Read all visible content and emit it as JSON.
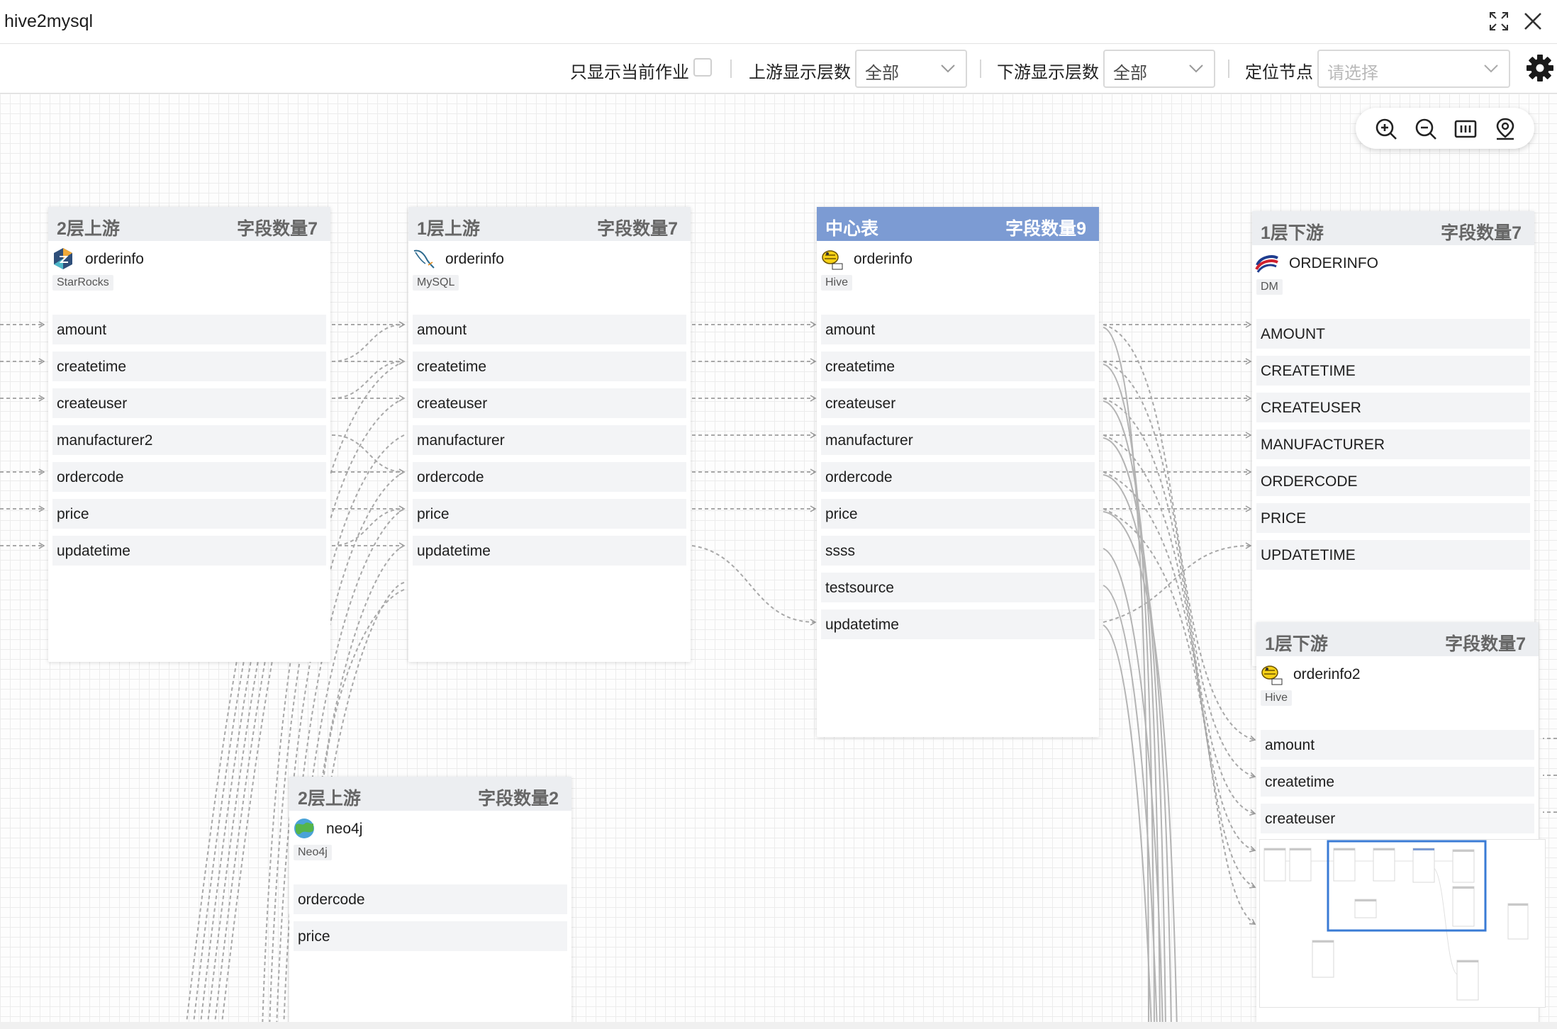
{
  "window": {
    "title": "hive2mysql",
    "controls": [
      "expand-icon",
      "close-icon"
    ]
  },
  "toolbar": {
    "only_current_label": "只显示当前作业",
    "upstream_label": "上游显示层数",
    "upstream_value": "全部",
    "downstream_label": "下游显示层数",
    "downstream_value": "全部",
    "locate_label": "定位节点",
    "locate_placeholder": "请选择",
    "settings_icon": "gear-icon"
  },
  "zoom_controls": [
    "zoom-in-icon",
    "zoom-out-icon",
    "fit-view-icon",
    "locate-icon"
  ],
  "nodes": {
    "up2_starrocks": {
      "level": "2层上游",
      "count": "字段数量7",
      "name": "orderinfo",
      "db": "StarRocks",
      "icon": "starrocks-icon",
      "fields": [
        "amount",
        "createtime",
        "createuser",
        "manufacturer2",
        "ordercode",
        "price",
        "updatetime"
      ]
    },
    "up1_mysql": {
      "level": "1层上游",
      "count": "字段数量7",
      "name": "orderinfo",
      "db": "MySQL",
      "icon": "mysql-dolphin-icon",
      "fields": [
        "amount",
        "createtime",
        "createuser",
        "manufacturer",
        "ordercode",
        "price",
        "updatetime"
      ]
    },
    "center_hive": {
      "level": "中心表",
      "count": "字段数量9",
      "name": "orderinfo",
      "db": "Hive",
      "icon": "hive-icon",
      "fields": [
        "amount",
        "createtime",
        "createuser",
        "manufacturer",
        "ordercode",
        "price",
        "ssss",
        "testsource",
        "updatetime"
      ]
    },
    "down1_dm": {
      "level": "1层下游",
      "count": "字段数量7",
      "name": "ORDERINFO",
      "db": "DM",
      "icon": "dm-icon",
      "fields": [
        "AMOUNT",
        "CREATETIME",
        "CREATEUSER",
        "MANUFACTURER",
        "ORDERCODE",
        "PRICE",
        "UPDATETIME"
      ]
    },
    "down1_hive2": {
      "level": "1层下游",
      "count": "字段数量7",
      "name": "orderinfo2",
      "db": "Hive",
      "icon": "hive-icon",
      "fields": [
        "amount",
        "createtime",
        "createuser"
      ]
    },
    "up2_neo4j": {
      "level": "2层上游",
      "count": "字段数量2",
      "name": "neo4j",
      "db": "Neo4j",
      "icon": "neo4j-icon",
      "fields": [
        "ordercode",
        "price"
      ]
    }
  },
  "colors": {
    "center_header": "#7c9bd3",
    "node_header": "#eceef1",
    "edge": "#a8a8a8",
    "minimap_viewport": "#3a7bd5"
  }
}
